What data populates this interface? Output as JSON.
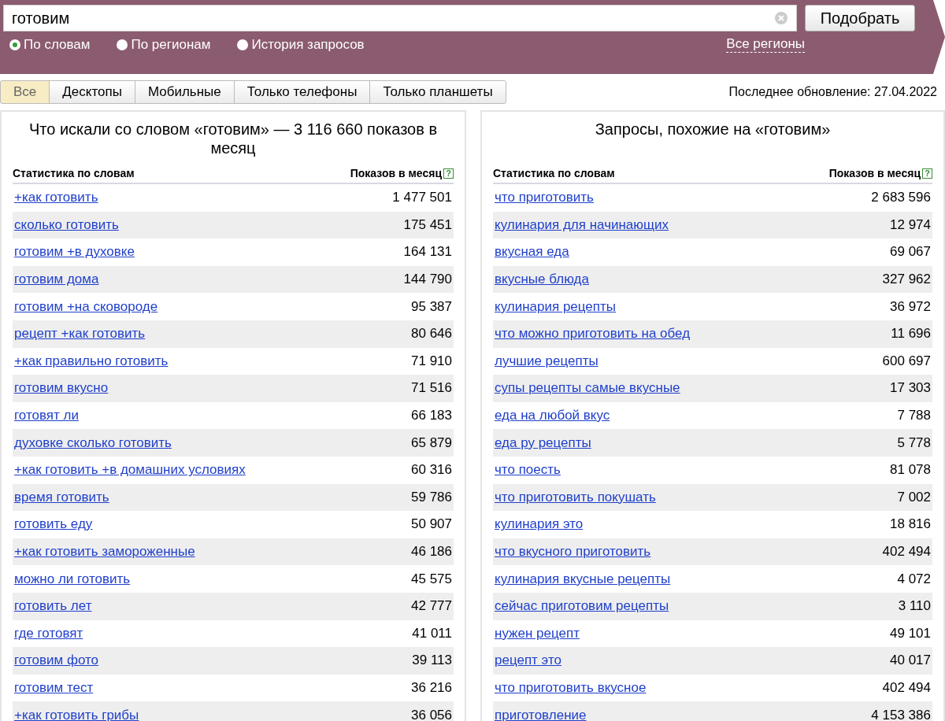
{
  "search": {
    "value": "готовим",
    "button": "Подобрать"
  },
  "modes": [
    {
      "label": "По словам",
      "selected": true
    },
    {
      "label": "По регионам",
      "selected": false
    },
    {
      "label": "История запросов",
      "selected": false
    }
  ],
  "regions_link": "Все регионы",
  "device_tabs": [
    {
      "label": "Все",
      "selected": true
    },
    {
      "label": "Десктопы",
      "selected": false
    },
    {
      "label": "Мобильные",
      "selected": false
    },
    {
      "label": "Только телефоны",
      "selected": false
    },
    {
      "label": "Только планшеты",
      "selected": false
    }
  ],
  "last_update": "Последнее обновление: 27.04.2022",
  "panels": [
    {
      "title": "Что искали со словом «готовим» — 3 116 660 показов в месяц",
      "column_1": "Статистика по словам",
      "column_2": "Показов в месяц",
      "help": "?",
      "rows": [
        {
          "phrase": "+как готовить",
          "count": "1 477 501"
        },
        {
          "phrase": "сколько готовить",
          "count": "175 451"
        },
        {
          "phrase": "готовим +в духовке",
          "count": "164 131"
        },
        {
          "phrase": "готовим дома",
          "count": "144 790"
        },
        {
          "phrase": "готовим +на сковороде",
          "count": "95 387"
        },
        {
          "phrase": "рецепт +как готовить",
          "count": "80 646"
        },
        {
          "phrase": "+как правильно готовить",
          "count": "71 910"
        },
        {
          "phrase": "готовим вкусно",
          "count": "71 516"
        },
        {
          "phrase": "готовят ли",
          "count": "66 183"
        },
        {
          "phrase": "духовке сколько готовить",
          "count": "65 879"
        },
        {
          "phrase": "+как готовить +в домашних условиях",
          "count": "60 316"
        },
        {
          "phrase": "время готовить",
          "count": "59 786"
        },
        {
          "phrase": "готовить еду",
          "count": "50 907"
        },
        {
          "phrase": "+как готовить замороженные",
          "count": "46 186"
        },
        {
          "phrase": "можно ли готовить",
          "count": "45 575"
        },
        {
          "phrase": "готовить лет",
          "count": "42 777"
        },
        {
          "phrase": "где готовят",
          "count": "41 011"
        },
        {
          "phrase": "готовим фото",
          "count": "39 113"
        },
        {
          "phrase": "готовим тест",
          "count": "36 216"
        },
        {
          "phrase": "+как готовить грибы",
          "count": "36 056"
        }
      ]
    },
    {
      "title": "Запросы, похожие на «готовим»",
      "column_1": "Статистика по словам",
      "column_2": "Показов в месяц",
      "help": "?",
      "rows": [
        {
          "phrase": "что приготовить",
          "count": "2 683 596"
        },
        {
          "phrase": "кулинария для начинающих",
          "count": "12 974"
        },
        {
          "phrase": "вкусная еда",
          "count": "69 067"
        },
        {
          "phrase": "вкусные блюда",
          "count": "327 962"
        },
        {
          "phrase": "кулинария рецепты",
          "count": "36 972"
        },
        {
          "phrase": "что можно приготовить на обед",
          "count": "11 696"
        },
        {
          "phrase": "лучшие рецепты",
          "count": "600 697"
        },
        {
          "phrase": "супы рецепты самые вкусные",
          "count": "17 303"
        },
        {
          "phrase": "еда на любой вкус",
          "count": "7 788"
        },
        {
          "phrase": "еда ру рецепты",
          "count": "5 778"
        },
        {
          "phrase": "что поесть",
          "count": "81 078"
        },
        {
          "phrase": "что приготовить покушать",
          "count": "7 002"
        },
        {
          "phrase": "кулинария это",
          "count": "18 816"
        },
        {
          "phrase": "что вкусного приготовить",
          "count": "402 494"
        },
        {
          "phrase": "кулинария вкусные рецепты",
          "count": "4 072"
        },
        {
          "phrase": "сейчас приготовим рецепты",
          "count": "3 110"
        },
        {
          "phrase": "нужен рецепт",
          "count": "49 101"
        },
        {
          "phrase": "рецепт это",
          "count": "40 017"
        },
        {
          "phrase": "что приготовить вкусное",
          "count": "402 494"
        },
        {
          "phrase": "приготовление",
          "count": "4 153 386"
        }
      ]
    }
  ]
}
